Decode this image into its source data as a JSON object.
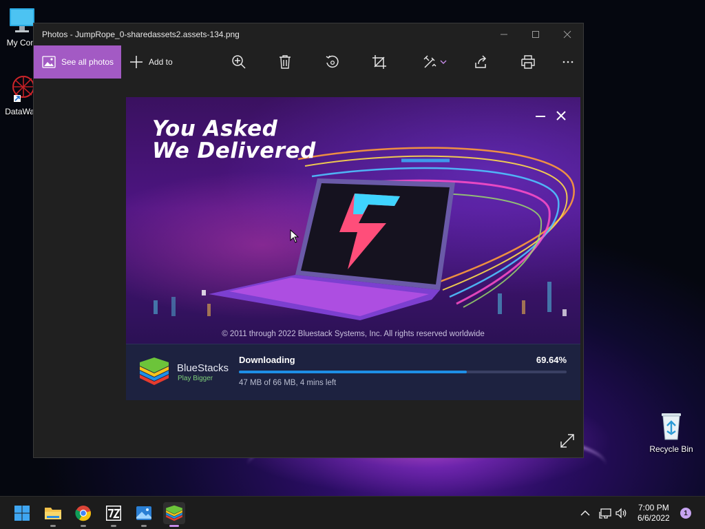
{
  "desktop": {
    "icons": [
      {
        "label": "My Com",
        "icon": "monitor-icon"
      },
      {
        "label": "DataWag",
        "icon": "datawag-icon"
      },
      {
        "label": "Recycle Bin",
        "icon": "recycle-bin-icon"
      }
    ]
  },
  "window": {
    "title": "Photos - JumpRope_0-sharedassets2.assets-134.png",
    "toolbar": {
      "see_all": "See all photos",
      "add_to": "Add to",
      "icons": [
        "zoom-in-icon",
        "delete-icon",
        "rotate-icon",
        "crop-icon",
        "edit-icon",
        "share-icon",
        "print-icon",
        "more-icon"
      ]
    }
  },
  "dialog": {
    "headline_line1": "You Asked",
    "headline_line2": "We Delivered",
    "copyright": "© 2011 through 2022 Bluestack Systems, Inc. All rights reserved worldwide",
    "brand_name": "BlueStacks",
    "brand_tagline": "Play Bigger",
    "status": "Downloading",
    "percent_text": "69.64%",
    "progress_fraction": 0.6964,
    "detail": "47 MB of 66 MB, 4 mins left"
  },
  "taskbar": {
    "apps": [
      "start-icon",
      "file-explorer-icon",
      "chrome-icon",
      "7zip-icon",
      "photos-icon",
      "bluestacks-icon"
    ],
    "time": "7:00 PM",
    "date": "6/6/2022",
    "notification_count": "1"
  }
}
